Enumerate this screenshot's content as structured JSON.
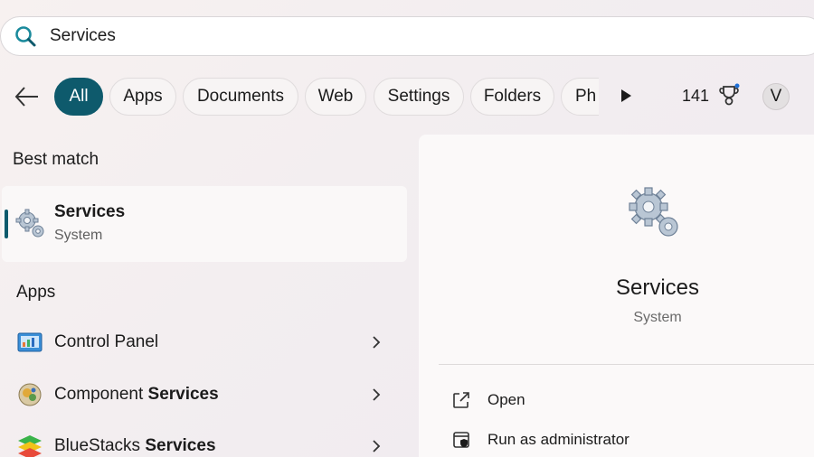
{
  "search": {
    "value": "Services",
    "icon": "search-icon"
  },
  "filters": {
    "back_icon": "back-arrow-icon",
    "chips": [
      "All",
      "Apps",
      "Documents",
      "Web",
      "Settings",
      "Folders",
      "Ph"
    ],
    "active": "All",
    "more_icon": "play-icon",
    "reward_points": "141",
    "reward_icon": "trophy-icon",
    "avatar_letter": "V"
  },
  "best_match": {
    "heading": "Best match",
    "title": "Services",
    "subtitle": "System",
    "icon": "gears-icon"
  },
  "apps": {
    "heading": "Apps",
    "items": [
      {
        "plain": "Control Panel",
        "bold": "",
        "icon": "control-panel-icon"
      },
      {
        "plain": "Component ",
        "bold": "Services",
        "icon": "component-services-icon"
      },
      {
        "plain": "BlueStacks ",
        "bold": "Services",
        "icon": "bluestacks-icon"
      }
    ]
  },
  "detail": {
    "title": "Services",
    "subtitle": "System",
    "actions": [
      {
        "label": "Open",
        "icon": "open-external-icon"
      },
      {
        "label": "Run as administrator",
        "icon": "shield-icon"
      }
    ]
  },
  "colors": {
    "accent": "#0e5a6c",
    "search_icon": "#1a8a9c"
  }
}
